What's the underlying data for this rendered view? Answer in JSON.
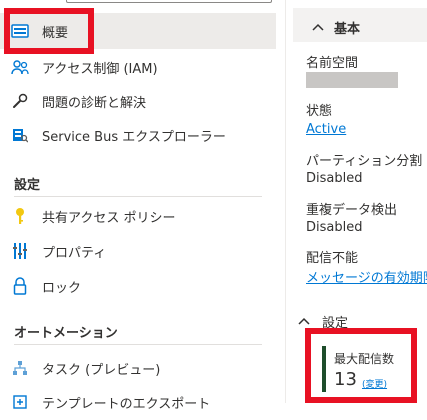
{
  "sidebar": {
    "items_top": [
      {
        "label": "概要",
        "icon": "overview-icon"
      },
      {
        "label": "アクセス制御 (IAM)",
        "icon": "people-icon"
      },
      {
        "label": "問題の診断と解決",
        "icon": "wrench-icon"
      },
      {
        "label": "Service Bus エクスプローラー",
        "icon": "explorer-icon"
      }
    ],
    "section_settings": "設定",
    "items_settings": [
      {
        "label": "共有アクセス ポリシー",
        "icon": "key-icon"
      },
      {
        "label": "プロパティ",
        "icon": "properties-icon"
      },
      {
        "label": "ロック",
        "icon": "lock-icon"
      }
    ],
    "section_automation": "オートメーション",
    "items_automation": [
      {
        "label": "タスク (プレビュー)",
        "icon": "tasks-icon"
      },
      {
        "label": "テンプレートのエクスポート",
        "icon": "export-template-icon"
      }
    ]
  },
  "essentials": {
    "header": "基本",
    "namespace_label": "名前空間",
    "status_label": "状態",
    "status_value": "Active",
    "partitioning_label": "パーティション分割",
    "partitioning_value": "Disabled",
    "duplicate_label": "重複データ検出",
    "duplicate_value": "Disabled",
    "deadletter_label": "配信不能",
    "deadletter_value": "メッセージの有効期限"
  },
  "settings_panel": {
    "header": "設定",
    "max_delivery_label": "最大配信数",
    "max_delivery_value": "13",
    "change_label": "(変更)"
  },
  "colors": {
    "accent": "#0078d4",
    "highlight_box": "#e81123",
    "tile_bar": "#1e4d2b"
  }
}
